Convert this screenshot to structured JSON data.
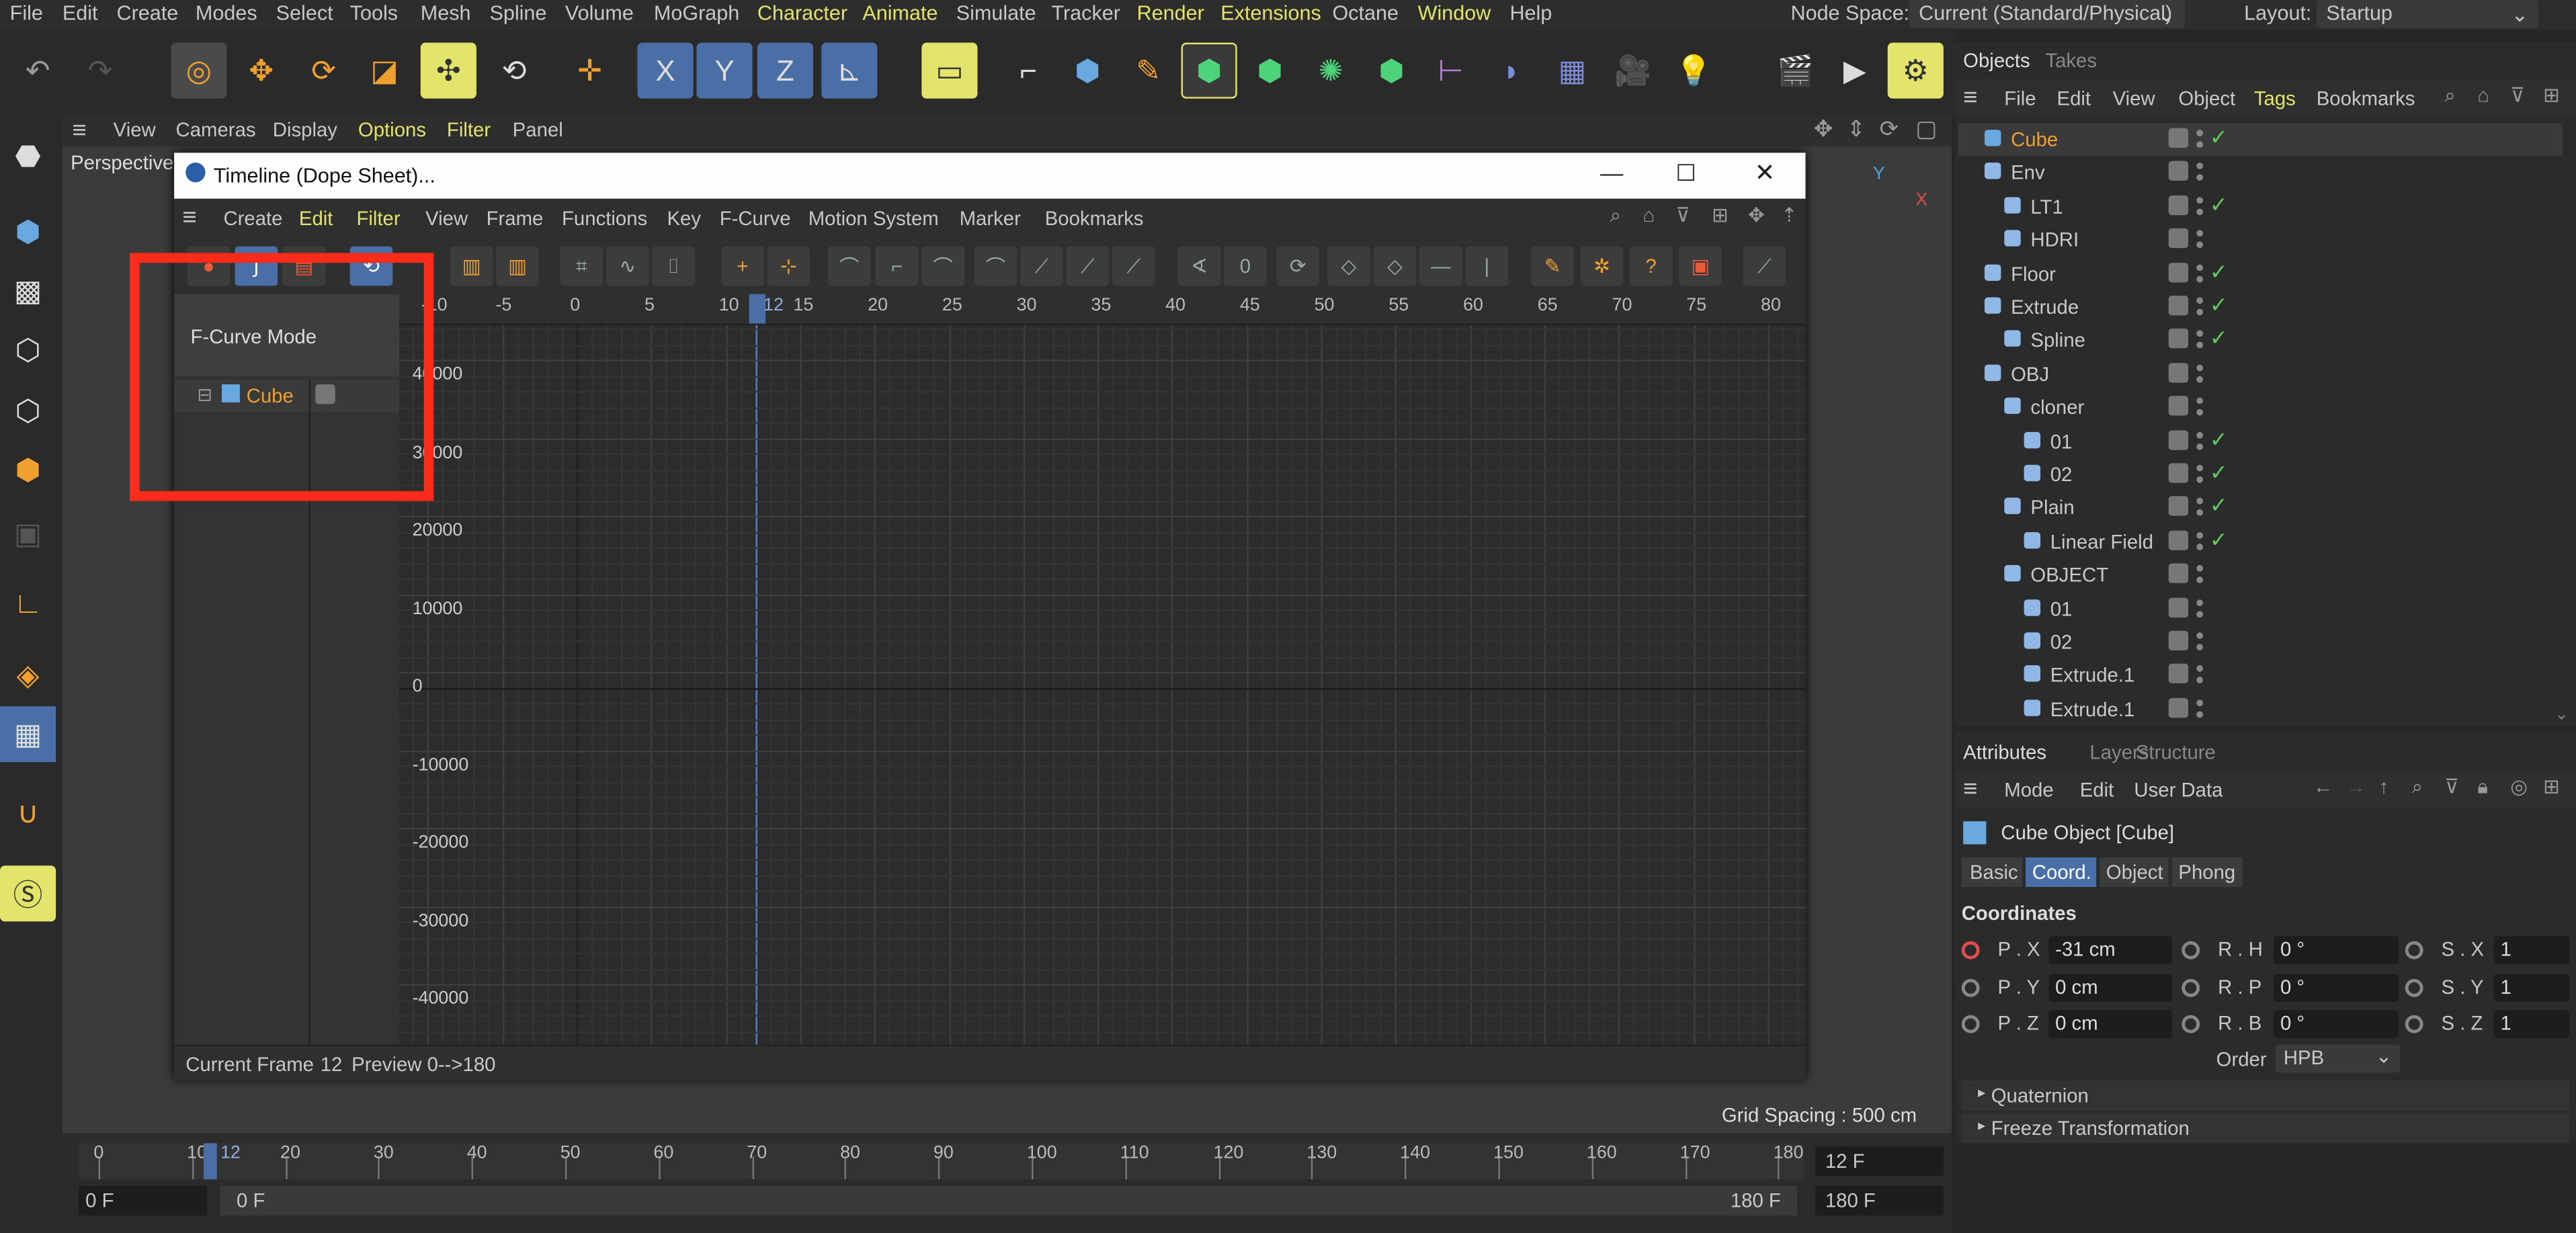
{
  "colors": {
    "accent": "#f0a030",
    "highlight": "#e3e46b",
    "selection": "#4a6fa6",
    "check": "#5fce5f",
    "annotation": "#ff2b1a"
  },
  "menubar": {
    "items": [
      "File",
      "Edit",
      "Create",
      "Modes",
      "Select",
      "Tools",
      "Mesh",
      "Spline",
      "Volume",
      "MoGraph",
      "Character",
      "Animate",
      "Simulate",
      "Tracker",
      "Render",
      "Extensions",
      "Octane",
      "Window",
      "Help"
    ],
    "node_space_label": "Node Space:",
    "node_space_value": "Current (Standard/Physical)",
    "layout_label": "Layout:",
    "layout_value": "Startup"
  },
  "toolbar": {
    "axis_x": "X",
    "axis_y": "Y",
    "axis_z": "Z"
  },
  "viewport": {
    "menu": [
      "View",
      "Cameras",
      "Display",
      "Options",
      "Filter",
      "Panel"
    ],
    "label": "Perspective",
    "grid_spacing": "Grid Spacing : 500 cm"
  },
  "timeline_window": {
    "title": "Timeline (Dope Sheet)...",
    "menu": [
      "Create",
      "Edit",
      "Filter",
      "View",
      "Frame",
      "Functions",
      "Key",
      "F-Curve",
      "Motion System",
      "Marker",
      "Bookmarks"
    ],
    "mode_label": "F-Curve Mode",
    "track_name": "Cube",
    "frame_ticks": [
      "-10",
      "-5",
      "0",
      "5",
      "10",
      "15",
      "20",
      "25",
      "30",
      "35",
      "40",
      "45",
      "50",
      "55",
      "60",
      "65",
      "70",
      "75",
      "80"
    ],
    "current_frame_marker": "12",
    "value_ticks": [
      "40000",
      "30000",
      "20000",
      "10000",
      "0",
      "-10000",
      "-20000",
      "-30000",
      "-40000"
    ],
    "status_label": "Current Frame",
    "status_frame": "12",
    "preview_label": "Preview",
    "preview_range": "0-->180"
  },
  "objects_panel": {
    "tabs": [
      "Objects",
      "Takes"
    ],
    "menu": [
      "File",
      "Edit",
      "View",
      "Object",
      "Tags",
      "Bookmarks"
    ],
    "rows": [
      {
        "name": "Cube",
        "indent": 0,
        "tick": true
      },
      {
        "name": "Env",
        "indent": 0,
        "tick": false
      },
      {
        "name": "LT1",
        "indent": 1,
        "tick": true
      },
      {
        "name": "HDRI",
        "indent": 1,
        "tick": false
      },
      {
        "name": "Floor",
        "indent": 0,
        "tick": true
      },
      {
        "name": "Extrude",
        "indent": 0,
        "tick": true
      },
      {
        "name": "Spline",
        "indent": 1,
        "tick": true
      },
      {
        "name": "OBJ",
        "indent": 0,
        "tick": false
      },
      {
        "name": "cloner",
        "indent": 1,
        "tick": false
      },
      {
        "name": "01",
        "indent": 2,
        "tick": true
      },
      {
        "name": "02",
        "indent": 2,
        "tick": true
      },
      {
        "name": "Plain",
        "indent": 1,
        "tick": true
      },
      {
        "name": "Linear Field",
        "indent": 2,
        "tick": true
      },
      {
        "name": "OBJECT",
        "indent": 1,
        "tick": false
      },
      {
        "name": "01",
        "indent": 2,
        "tick": false
      },
      {
        "name": "02",
        "indent": 2,
        "tick": false
      },
      {
        "name": "Extrude.1",
        "indent": 2,
        "tick": false
      },
      {
        "name": "Extrude.1",
        "indent": 2,
        "tick": false
      }
    ]
  },
  "attributes_panel": {
    "tabs": [
      "Attributes",
      "Layers",
      "Structure"
    ],
    "menu": [
      "Mode",
      "Edit",
      "User Data"
    ],
    "object_title": "Cube Object [Cube]",
    "subtabs": [
      "Basic",
      "Coord.",
      "Object",
      "Phong"
    ],
    "section": "Coordinates",
    "fields": [
      {
        "label": "P . X",
        "value": "-31 cm"
      },
      {
        "label": "R . H",
        "value": "0 °"
      },
      {
        "label": "S . X",
        "value": "1"
      },
      {
        "label": "P . Y",
        "value": "0 cm"
      },
      {
        "label": "R . P",
        "value": "0 °"
      },
      {
        "label": "S . Y",
        "value": "1"
      },
      {
        "label": "P . Z",
        "value": "0 cm"
      },
      {
        "label": "R . B",
        "value": "0 °"
      },
      {
        "label": "S . Z",
        "value": "1"
      }
    ],
    "order_label": "Order",
    "order_value": "HPB",
    "collapsed": [
      "Quaternion",
      "Freeze Transformation"
    ]
  },
  "bottom_timeline": {
    "ticks": [
      "0",
      "10",
      "20",
      "30",
      "40",
      "50",
      "60",
      "70",
      "80",
      "90",
      "100",
      "110",
      "120",
      "130",
      "140",
      "150",
      "160",
      "170",
      "180"
    ],
    "current": "12",
    "current_field": "12 F",
    "start": "0 F",
    "range_start": "0 F",
    "range_end": "180 F",
    "end_field": "180 F"
  }
}
